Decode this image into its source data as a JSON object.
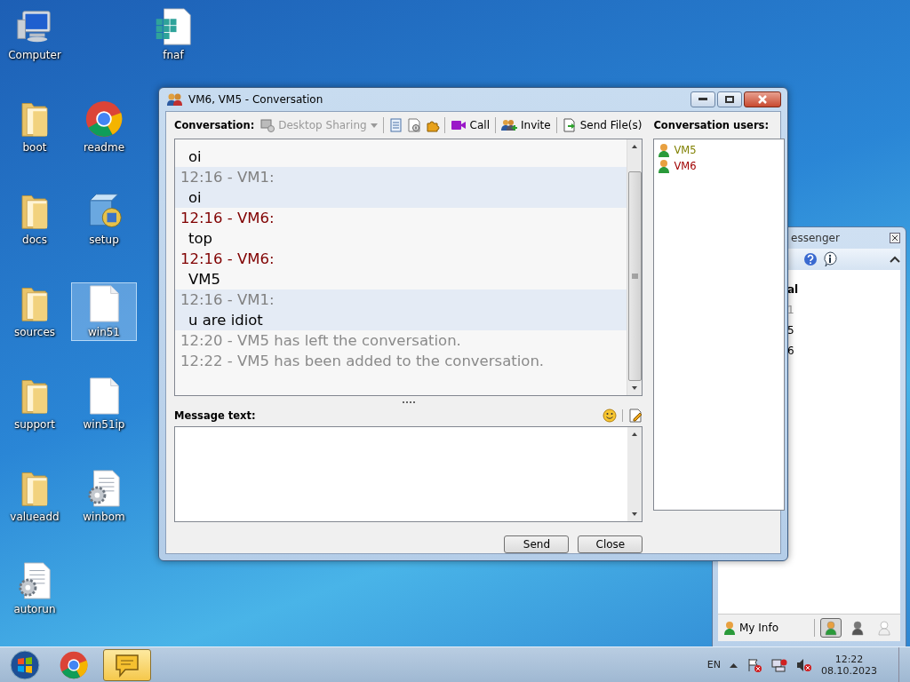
{
  "desktop_icons": [
    {
      "label": "Computer",
      "kind": "computer",
      "selected": false
    },
    {
      "label": "fnaf",
      "kind": "grid-doc",
      "selected": false
    },
    {
      "label": "boot",
      "kind": "folder",
      "selected": false
    },
    {
      "label": "readme",
      "kind": "chrome",
      "selected": false
    },
    {
      "label": "docs",
      "kind": "folder",
      "selected": false
    },
    {
      "label": "setup",
      "kind": "installer",
      "selected": false
    },
    {
      "label": "sources",
      "kind": "folder",
      "selected": false
    },
    {
      "label": "win51",
      "kind": "file",
      "selected": true
    },
    {
      "label": "support",
      "kind": "folder",
      "selected": false
    },
    {
      "label": "win51ip",
      "kind": "file",
      "selected": false
    },
    {
      "label": "valueadd",
      "kind": "folder",
      "selected": false
    },
    {
      "label": "winbom",
      "kind": "script",
      "selected": false
    },
    {
      "label": "autorun",
      "kind": "script",
      "selected": false
    }
  ],
  "conversation_window": {
    "title": "VM6, VM5 - Conversation",
    "conversation_label": "Conversation:",
    "toolbar": [
      {
        "kind": "dropdown",
        "label": "Desktop Sharing",
        "disabled": true
      },
      {
        "kind": "notebook"
      },
      {
        "kind": "document"
      },
      {
        "kind": "puzzle"
      },
      {
        "kind": "call",
        "label": "Call"
      },
      {
        "kind": "invite",
        "label": "Invite"
      },
      {
        "kind": "send-file",
        "label": "Send File(s)"
      }
    ],
    "messages": [
      {
        "kind": "message",
        "body": "oi",
        "highlighted": false
      },
      {
        "kind": "message",
        "header": "12:16 - VM1:",
        "body": "oi",
        "highlighted": true,
        "color": "#808080"
      },
      {
        "kind": "message",
        "header": "12:16 - VM6:",
        "body": "top",
        "highlighted": false,
        "color": "#800000"
      },
      {
        "kind": "message",
        "header": "12:16 - VM6:",
        "body": "VM5",
        "highlighted": false,
        "color": "#800000"
      },
      {
        "kind": "message",
        "header": "12:16 - VM1:",
        "body": "u are idiot",
        "highlighted": true,
        "color": "#808080"
      },
      {
        "kind": "event",
        "text": "12:20 - VM5 has left the conversation."
      },
      {
        "kind": "event",
        "text": "12:22 - VM5 has been added to the conversation."
      }
    ],
    "message_label": "Message text:",
    "users_label": "Conversation users:",
    "users": [
      {
        "name": "VM5",
        "color": "#808000"
      },
      {
        "name": "VM6",
        "color": "#a00000"
      }
    ],
    "buttons": [
      "Send",
      "Close"
    ]
  },
  "messenger_window": {
    "title": "essenger",
    "contacts": [
      {
        "text": "al",
        "kind": "group"
      },
      {
        "text": "1",
        "kind": "offline"
      },
      {
        "text": "5",
        "kind": "online"
      },
      {
        "text": "6",
        "kind": "online"
      }
    ],
    "my_info": "My Info",
    "statuses": [
      {
        "kind": "online",
        "selected": true
      },
      {
        "kind": "away",
        "selected": false
      },
      {
        "kind": "offline",
        "selected": false
      }
    ]
  },
  "taskbar": {
    "apps": [
      {
        "kind": "chrome",
        "selected": false
      },
      {
        "kind": "messenger",
        "selected": true
      }
    ],
    "language": "EN",
    "time": "12:22",
    "date": "08.10.2023"
  }
}
